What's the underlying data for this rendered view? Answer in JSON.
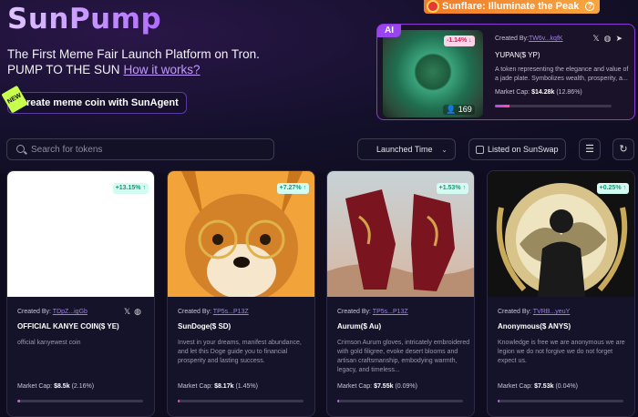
{
  "brand": {
    "logo_text": "SunPump"
  },
  "banner": {
    "text": "Sunflare: Illuminate the Peak"
  },
  "hero": {
    "line1": "The First Meme Fair Launch Platform on Tron.",
    "line2": "PUMP TO THE SUN",
    "link": "How it works?",
    "cta": "Create meme coin with SunAgent",
    "cta_badge": "NEW"
  },
  "featured": {
    "badge": "AI",
    "change": "-1.14%",
    "holders": "169",
    "created_by_label": "Created By:",
    "creator": "TW6v...kqfK",
    "name": "YUPAN($ YP)",
    "description": "A token representing the elegance and value of a jade plate. Symbolizes wealth, prosperity, a...",
    "market_cap_label": "Market Cap:",
    "market_cap": "$14.28k",
    "market_cap_pct": "(12.86%)",
    "progress": 12.86
  },
  "toolbar": {
    "search_placeholder": "Search for tokens",
    "sort_value": "Launched Time",
    "listed_label": "Listed on SunSwap"
  },
  "cards": [
    {
      "change": "+13.15%",
      "created_by_label": "Created By:",
      "creator": "TDpZ...igGb",
      "name": "OFFICIAL KANYE COIN($ YE)",
      "description": "official kanyewest coin",
      "market_cap_label": "Market Cap:",
      "market_cap": "$8.5k",
      "market_cap_pct": "(2.16%)",
      "progress": 2.16
    },
    {
      "change": "+7.27%",
      "created_by_label": "Created By:",
      "creator": "TP5s...P13Z",
      "name": "SunDoge($ SD)",
      "description": "Invest in your dreams, manifest abundance, and let this Doge guide you to financial prosperity and lasting success.",
      "market_cap_label": "Market Cap:",
      "market_cap": "$8.17k",
      "market_cap_pct": "(1.45%)",
      "progress": 1.45
    },
    {
      "change": "+1.53%",
      "created_by_label": "Created By:",
      "creator": "TP5s...P13Z",
      "name": "Aurum($ Au)",
      "description": "Crimson Aurum gloves, intricately embroidered with gold filigree, evoke desert blooms and artisan craftsmanship, embodying warmth, legacy, and timeless...",
      "market_cap_label": "Market Cap:",
      "market_cap": "$7.55k",
      "market_cap_pct": "(0.09%)",
      "progress": 0.09
    },
    {
      "change": "+0.25%",
      "created_by_label": "Created By:",
      "creator": "TVRB...yeuY",
      "name": "Anonymous($ ANYS)",
      "description": "Knowledge is free we are anonymous we are legion we do not forgive we do not forget expect us.",
      "market_cap_label": "Market Cap:",
      "market_cap": "$7.53k",
      "market_cap_pct": "(0.04%)",
      "progress": 0.04
    }
  ],
  "colors": {
    "accent": "#9a44ef",
    "up": "#0c9c7a",
    "down": "#d2245c",
    "banner": "#f07b2a"
  }
}
